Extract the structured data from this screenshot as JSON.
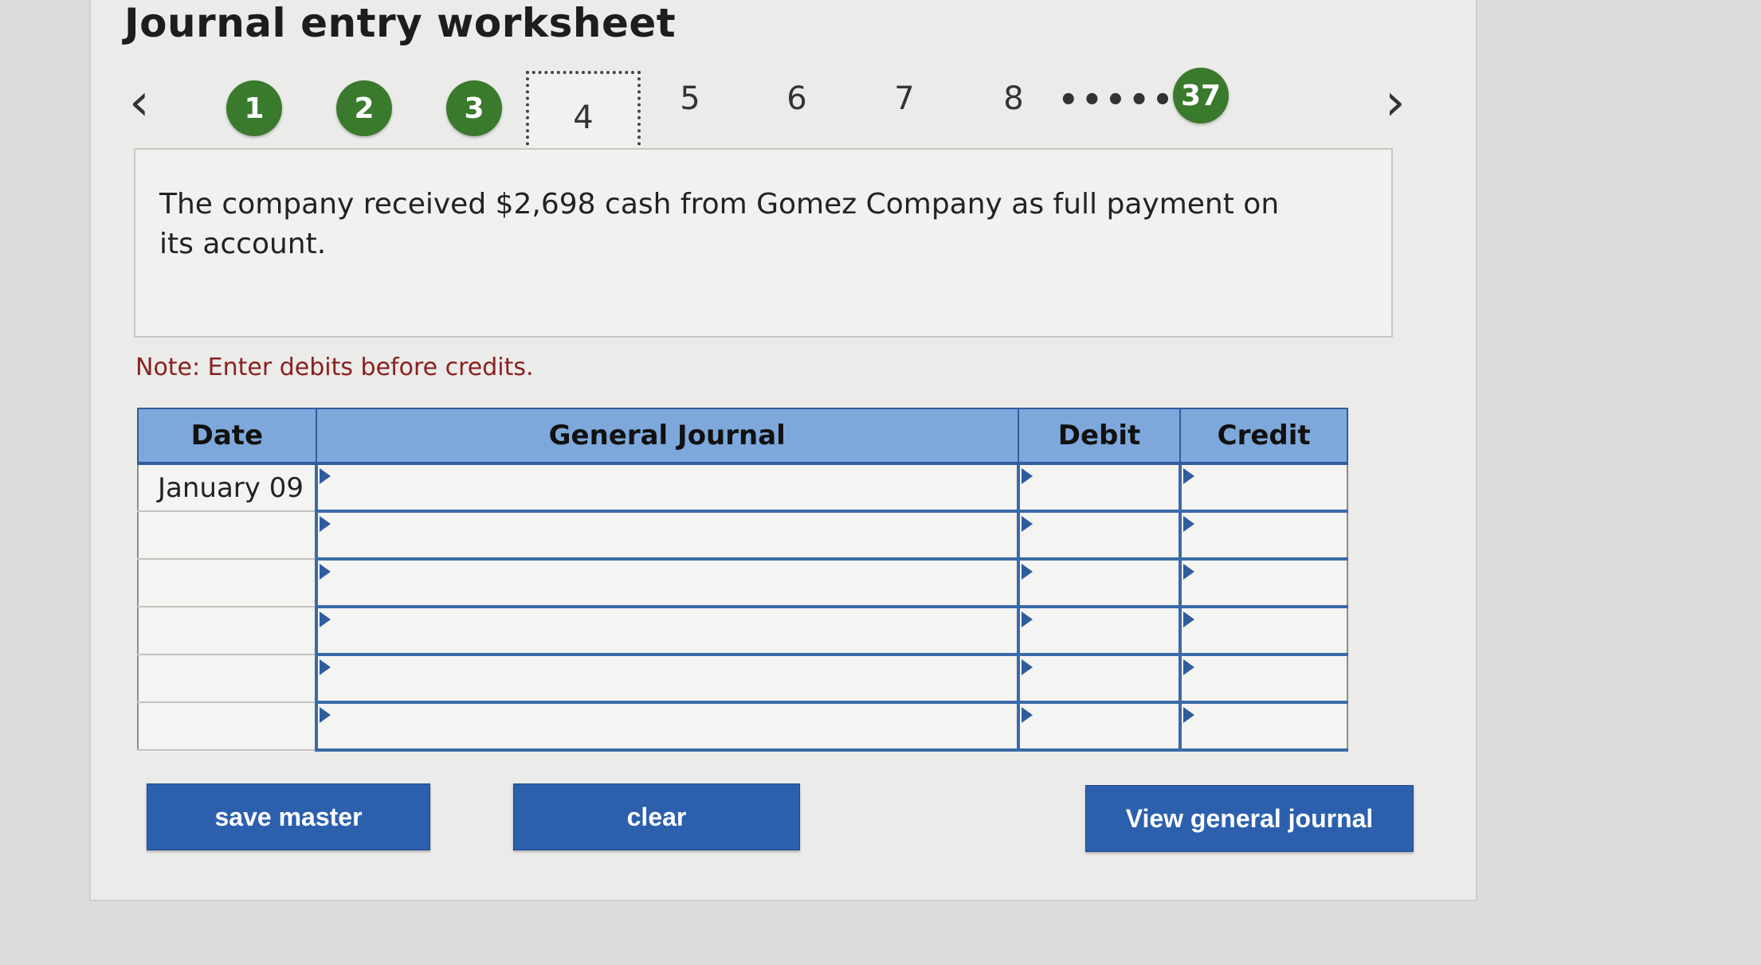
{
  "title": "Journal entry worksheet",
  "pager": {
    "prev_icon": "chevron-left-icon",
    "next_icon": "chevron-right-icon",
    "prev_glyph": "‹",
    "next_glyph": "›",
    "completed": [
      "1",
      "2",
      "3"
    ],
    "current": "4",
    "upcoming": [
      "5",
      "6",
      "7",
      "8"
    ],
    "ellipsis": "•••••",
    "last": "37"
  },
  "prompt": "The company received $2,698 cash from Gomez Company as full payment on its account.",
  "note": "Note: Enter debits before credits.",
  "table": {
    "headers": {
      "date": "Date",
      "general_journal": "General Journal",
      "debit": "Debit",
      "credit": "Credit"
    },
    "rows": [
      {
        "date": "January 09",
        "account": "",
        "debit": "",
        "credit": ""
      },
      {
        "date": "",
        "account": "",
        "debit": "",
        "credit": ""
      },
      {
        "date": "",
        "account": "",
        "debit": "",
        "credit": ""
      },
      {
        "date": "",
        "account": "",
        "debit": "",
        "credit": ""
      },
      {
        "date": "",
        "account": "",
        "debit": "",
        "credit": ""
      },
      {
        "date": "",
        "account": "",
        "debit": "",
        "credit": ""
      }
    ]
  },
  "buttons": {
    "save": "save master",
    "clear": "clear",
    "view": "View general journal"
  },
  "colors": {
    "completed_dot": "#3a7a2c",
    "header_bg": "#7ea8db",
    "button_bg": "#2c60ad",
    "note_text": "#8a2020"
  }
}
